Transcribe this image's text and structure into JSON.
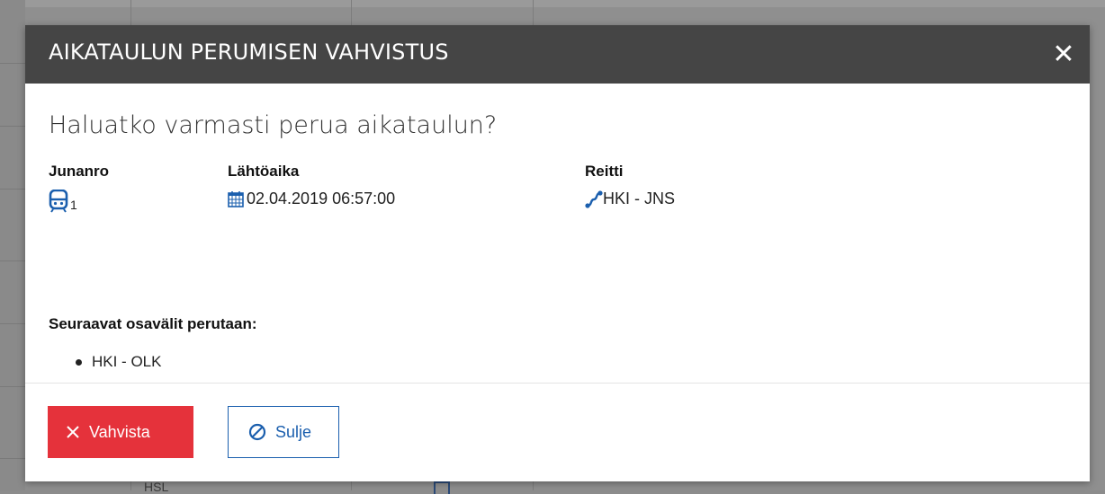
{
  "dialog": {
    "title": "AIKATAULUN PERUMISEN VAHVISTUS",
    "close_symbol": "✕",
    "question": "Haluatko varmasti perua aikataulun?"
  },
  "fields": {
    "train": {
      "label": "Junanro",
      "value": "1",
      "icon": "train-icon"
    },
    "departure": {
      "label": "Lähtöaika",
      "value": "02.04.2019 06:57:00",
      "icon": "calendar-icon"
    },
    "route": {
      "label": "Reitti",
      "value": "HKI - JNS",
      "icon": "route-icon"
    }
  },
  "segments": {
    "title": "Seuraavat osavälit perutaan:",
    "items": [
      "HKI - OLK"
    ]
  },
  "buttons": {
    "confirm": "Vahvista",
    "close": "Sulje"
  },
  "background": {
    "bottom_text": "HSL"
  },
  "colors": {
    "header_bg": "#454545",
    "confirm_bg": "#e5323b",
    "accent_blue": "#1b5fae"
  }
}
